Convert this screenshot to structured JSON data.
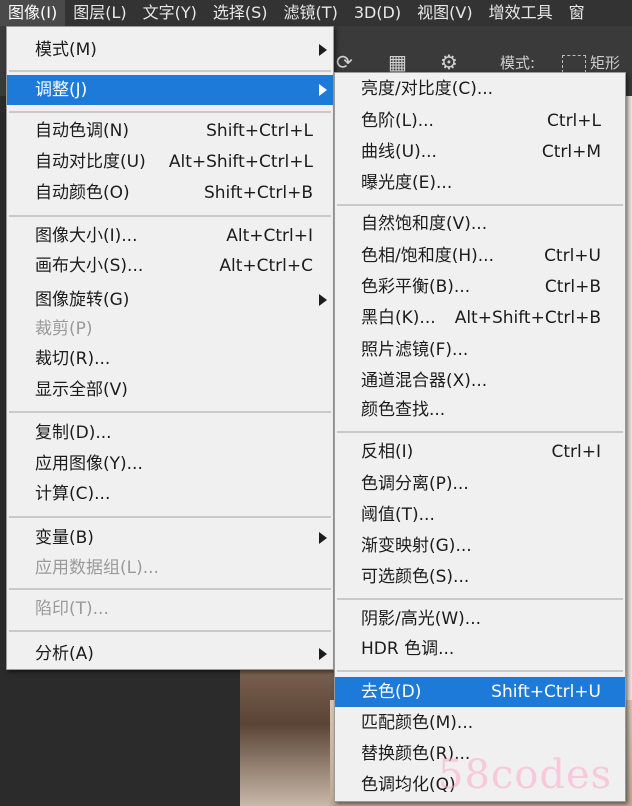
{
  "menubar": {
    "items": [
      "图像(I)",
      "图层(L)",
      "文字(Y)",
      "选择(S)",
      "滤镜(T)",
      "3D(D)",
      "视图(V)",
      "增效工具",
      "窗"
    ]
  },
  "toolbar": {
    "mode_label": "模式:",
    "shape_label": "矩形"
  },
  "image_menu": {
    "items": [
      {
        "label": "模式(M)",
        "submenu": true
      },
      {
        "label": "调整(J)",
        "submenu": true,
        "highlighted": true
      },
      {
        "label": "自动色调(N)",
        "shortcut": "Shift+Ctrl+L"
      },
      {
        "label": "自动对比度(U)",
        "shortcut": "Alt+Shift+Ctrl+L"
      },
      {
        "label": "自动颜色(O)",
        "shortcut": "Shift+Ctrl+B"
      },
      {
        "label": "图像大小(I)...",
        "shortcut": "Alt+Ctrl+I"
      },
      {
        "label": "画布大小(S)...",
        "shortcut": "Alt+Ctrl+C"
      },
      {
        "label": "图像旋转(G)",
        "submenu": true
      },
      {
        "label": "裁剪(P)",
        "disabled": true
      },
      {
        "label": "裁切(R)..."
      },
      {
        "label": "显示全部(V)"
      },
      {
        "label": "复制(D)..."
      },
      {
        "label": "应用图像(Y)..."
      },
      {
        "label": "计算(C)..."
      },
      {
        "label": "变量(B)",
        "submenu": true
      },
      {
        "label": "应用数据组(L)...",
        "disabled": true
      },
      {
        "label": "陷印(T)...",
        "disabled": true
      },
      {
        "label": "分析(A)",
        "submenu": true
      }
    ]
  },
  "adjust_menu": {
    "items": [
      {
        "label": "亮度/对比度(C)..."
      },
      {
        "label": "色阶(L)...",
        "shortcut": "Ctrl+L"
      },
      {
        "label": "曲线(U)...",
        "shortcut": "Ctrl+M"
      },
      {
        "label": "曝光度(E)..."
      },
      {
        "label": "自然饱和度(V)..."
      },
      {
        "label": "色相/饱和度(H)...",
        "shortcut": "Ctrl+U"
      },
      {
        "label": "色彩平衡(B)...",
        "shortcut": "Ctrl+B"
      },
      {
        "label": "黑白(K)...",
        "shortcut": "Alt+Shift+Ctrl+B"
      },
      {
        "label": "照片滤镜(F)..."
      },
      {
        "label": "通道混合器(X)..."
      },
      {
        "label": "颜色查找..."
      },
      {
        "label": "反相(I)",
        "shortcut": "Ctrl+I"
      },
      {
        "label": "色调分离(P)..."
      },
      {
        "label": "阈值(T)..."
      },
      {
        "label": "渐变映射(G)..."
      },
      {
        "label": "可选颜色(S)..."
      },
      {
        "label": "阴影/高光(W)..."
      },
      {
        "label": "HDR 色调..."
      },
      {
        "label": "去色(D)",
        "shortcut": "Shift+Ctrl+U",
        "highlighted": true
      },
      {
        "label": "匹配颜色(M)..."
      },
      {
        "label": "替换颜色(R)..."
      },
      {
        "label": "色调均化(Q)"
      }
    ]
  },
  "watermark": "58codes"
}
